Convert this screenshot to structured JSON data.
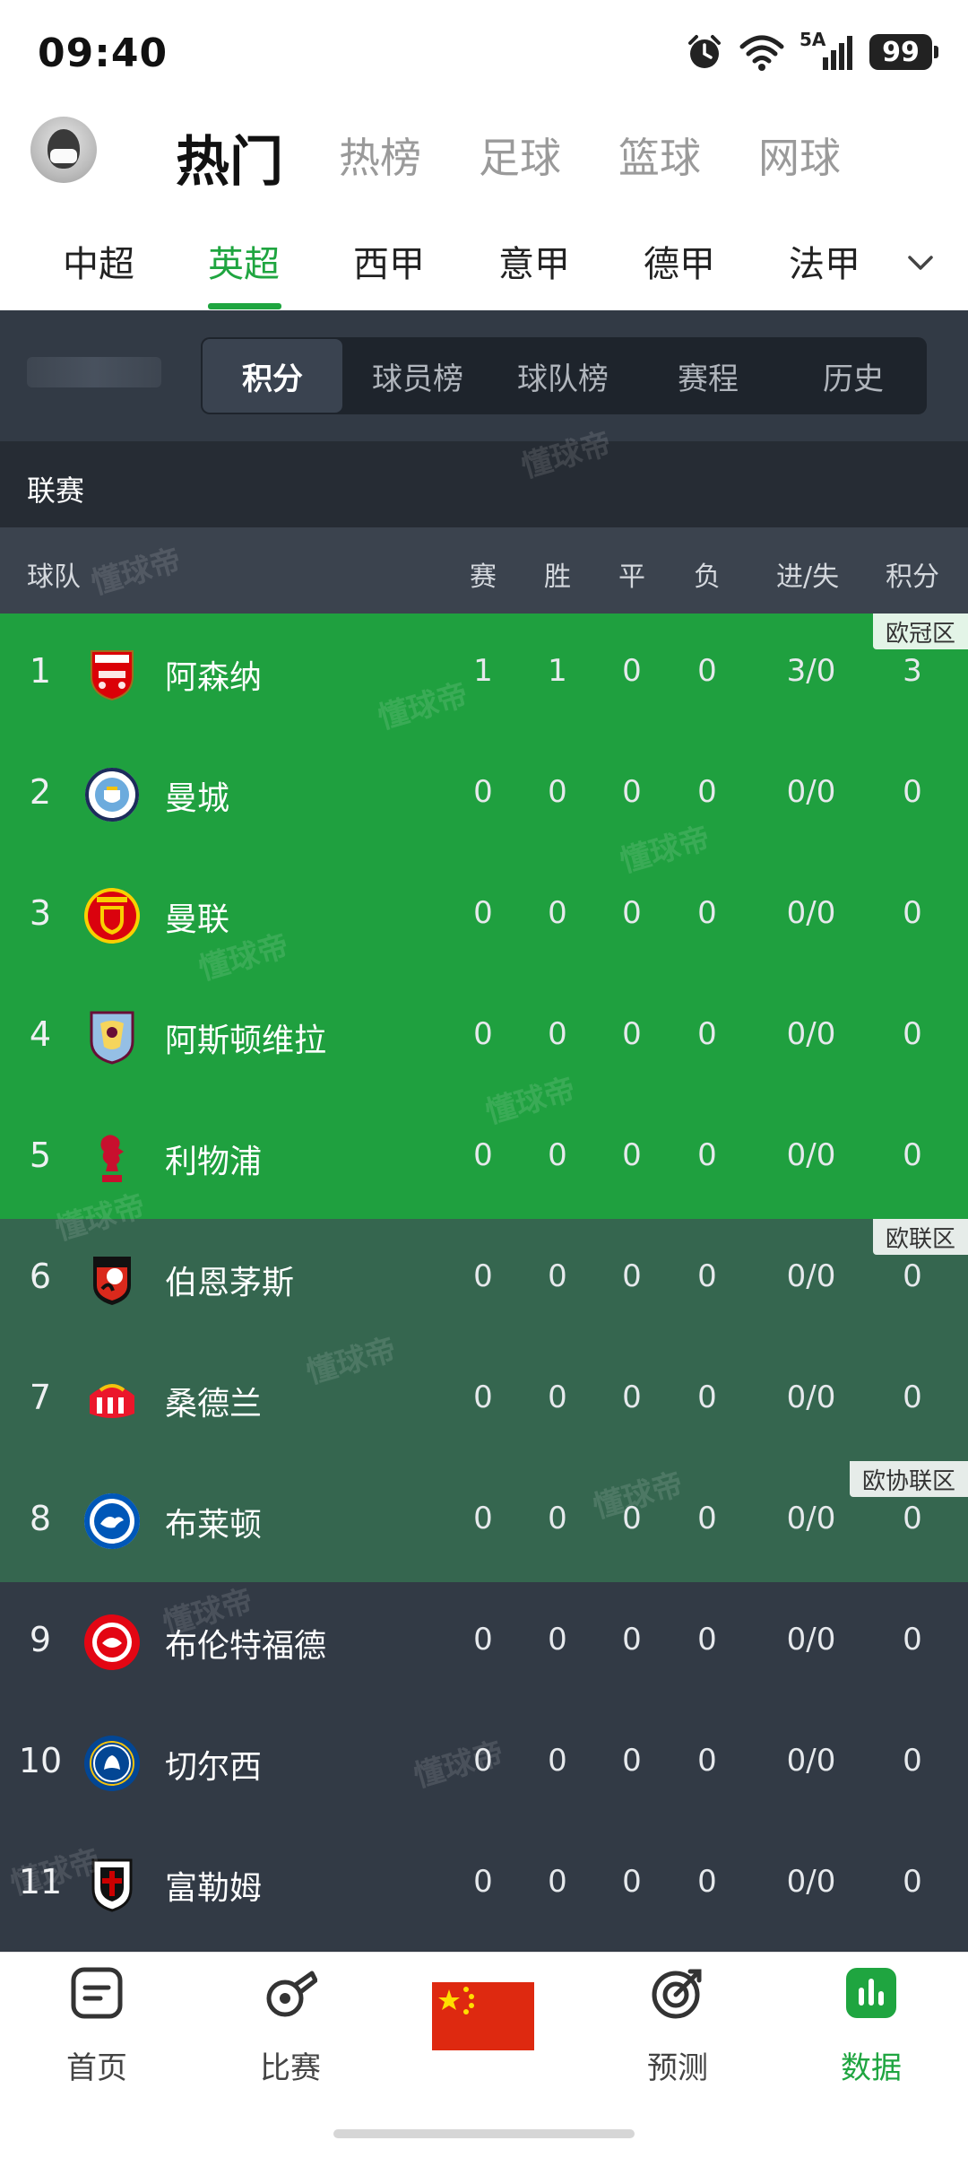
{
  "status_bar": {
    "time": "09:40",
    "network": "5A",
    "battery": "99"
  },
  "top_tabs": [
    "热门",
    "热榜",
    "足球",
    "篮球",
    "网球"
  ],
  "league_tabs": [
    "中超",
    "英超",
    "西甲",
    "意甲",
    "德甲",
    "法甲"
  ],
  "segments": [
    "积分",
    "球员榜",
    "球队榜",
    "赛程",
    "历史"
  ],
  "section_label": "联赛",
  "columns": {
    "team": "球队",
    "played": "赛",
    "won": "胜",
    "drawn": "平",
    "lost": "负",
    "goals": "进/失",
    "points": "积分"
  },
  "zone_tags": {
    "ucl": "欧冠区",
    "uel": "欧联区",
    "uecl": "欧协联区"
  },
  "watermark": "懂球帝",
  "teams": [
    {
      "rank": "1",
      "name": "阿森纳",
      "played": "1",
      "won": "1",
      "drawn": "0",
      "lost": "0",
      "goals": "3/0",
      "points": "3",
      "crest": "arsenal-crest"
    },
    {
      "rank": "2",
      "name": "曼城",
      "played": "0",
      "won": "0",
      "drawn": "0",
      "lost": "0",
      "goals": "0/0",
      "points": "0",
      "crest": "man-city-crest"
    },
    {
      "rank": "3",
      "name": "曼联",
      "played": "0",
      "won": "0",
      "drawn": "0",
      "lost": "0",
      "goals": "0/0",
      "points": "0",
      "crest": "man-united-crest"
    },
    {
      "rank": "4",
      "name": "阿斯顿维拉",
      "played": "0",
      "won": "0",
      "drawn": "0",
      "lost": "0",
      "goals": "0/0",
      "points": "0",
      "crest": "aston-villa-crest"
    },
    {
      "rank": "5",
      "name": "利物浦",
      "played": "0",
      "won": "0",
      "drawn": "0",
      "lost": "0",
      "goals": "0/0",
      "points": "0",
      "crest": "liverpool-crest"
    },
    {
      "rank": "6",
      "name": "伯恩茅斯",
      "played": "0",
      "won": "0",
      "drawn": "0",
      "lost": "0",
      "goals": "0/0",
      "points": "0",
      "crest": "bournemouth-crest"
    },
    {
      "rank": "7",
      "name": "桑德兰",
      "played": "0",
      "won": "0",
      "drawn": "0",
      "lost": "0",
      "goals": "0/0",
      "points": "0",
      "crest": "sunderland-crest"
    },
    {
      "rank": "8",
      "name": "布莱顿",
      "played": "0",
      "won": "0",
      "drawn": "0",
      "lost": "0",
      "goals": "0/0",
      "points": "0",
      "crest": "brighton-crest"
    },
    {
      "rank": "9",
      "name": "布伦特福德",
      "played": "0",
      "won": "0",
      "drawn": "0",
      "lost": "0",
      "goals": "0/0",
      "points": "0",
      "crest": "brentford-crest"
    },
    {
      "rank": "10",
      "name": "切尔西",
      "played": "0",
      "won": "0",
      "drawn": "0",
      "lost": "0",
      "goals": "0/0",
      "points": "0",
      "crest": "chelsea-crest"
    },
    {
      "rank": "11",
      "name": "富勒姆",
      "played": "0",
      "won": "0",
      "drawn": "0",
      "lost": "0",
      "goals": "0/0",
      "points": "0",
      "crest": "fulham-crest"
    }
  ],
  "bottom_nav": [
    "首页",
    "比赛",
    "预测",
    "数据"
  ],
  "colors": {
    "accent": "#1fa540",
    "ucl_zone": "#1fa03f",
    "uel_zone": "#35664f",
    "table_bg": "#323a45"
  }
}
